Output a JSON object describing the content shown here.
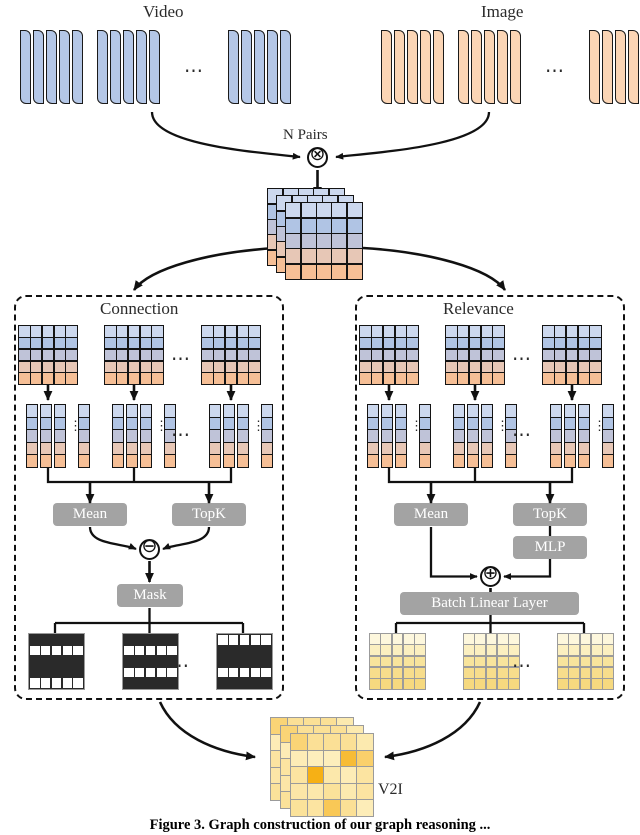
{
  "figure": {
    "caption": "Figure 3. Graph construction of our graph reasoning ...",
    "top_labels": {
      "video": "Video",
      "image": "Image"
    },
    "pair_label": "N Pairs",
    "output_label": "V2I"
  },
  "branches": {
    "connection": {
      "title": "Connection",
      "ops": {
        "mean": "Mean",
        "topk": "TopK",
        "mask": "Mask"
      },
      "combine_symbol": "⊖",
      "matrix_ellipsis": "⋯",
      "vector_ellipsis": "⋮"
    },
    "relevance": {
      "title": "Relevance",
      "ops": {
        "mean": "Mean",
        "topk": "TopK",
        "mlp": "MLP",
        "linear": "Batch Linear Layer"
      },
      "combine_symbol": "⊕",
      "matrix_ellipsis": "⋯",
      "vector_ellipsis": "⋮"
    }
  },
  "nodes": {
    "multiply_symbol": "⊗"
  },
  "colors": {
    "blue_sheet": "#b4c7e7",
    "orange_sheet": "#fbd5b5",
    "gray_button": "#a3a3a3",
    "mask_dark": "#2a2a2a",
    "mask_light": "#ffffff",
    "yellow_light": "#fdf4cf",
    "yellow_deep": "#f6d66a",
    "highlight": "#f5a800",
    "stroke": "#111111"
  },
  "chart_data": {
    "type": "diagram",
    "title": "Graph construction pipeline",
    "gradient_matrix_rows": [
      "#ccd8ee",
      "#b0c4e4",
      "#bfc3d8",
      "#e7c7b6",
      "#f6bf96"
    ],
    "input_stacks": {
      "video_groups": 3,
      "image_groups": 3,
      "sheets_per_group": 5
    },
    "pair_matrix": {
      "rows": 5,
      "cols": 5,
      "depth": 3
    },
    "branch_matrices": {
      "groups": 3,
      "rows": 5,
      "cols": 5
    },
    "column_vectors": {
      "groups": 3,
      "vectors_shown": 4,
      "cells": 5
    },
    "mask_matrices": [
      {
        "name": "mask-1",
        "rows": [
          0,
          1,
          0,
          0,
          1
        ]
      },
      {
        "name": "mask-2",
        "rows": [
          0,
          1,
          0,
          1,
          0
        ]
      },
      {
        "name": "mask-3",
        "rows": [
          1,
          0,
          0,
          1,
          0
        ]
      }
    ],
    "yellow_matrix_rows": [
      "#fdf7dd",
      "#fbefc0",
      "#f8e49c",
      "#f7dd8c",
      "#f6d97f"
    ],
    "v2i_matrix": [
      [
        0.45,
        0.3,
        0.3,
        0.3,
        0.18
      ],
      [
        0.15,
        0.12,
        0.12,
        0.75,
        0.5
      ],
      [
        0.25,
        0.9,
        0.2,
        0.15,
        0.25
      ],
      [
        0.22,
        0.2,
        0.28,
        0.18,
        0.25
      ],
      [
        0.28,
        0.25,
        0.6,
        0.3,
        0.14
      ]
    ],
    "v2i_depth": 3
  }
}
